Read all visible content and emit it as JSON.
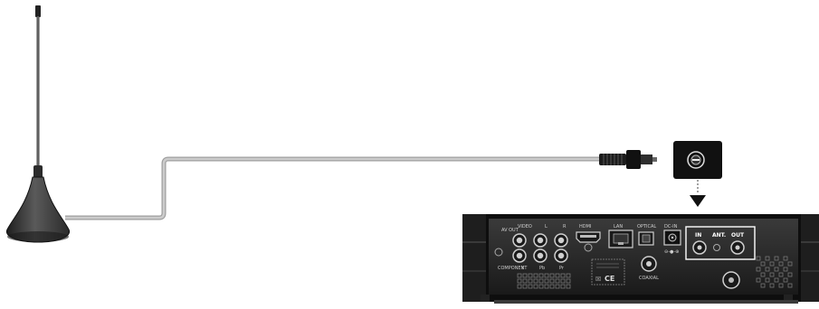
{
  "diagram": {
    "panel_labels": {
      "av_out": "AV OUT",
      "video": "VIDEO",
      "left": "L",
      "right": "R",
      "hdmi": "HDMI",
      "lan": "LAN",
      "optical": "OPTICAL",
      "dc_in": "DC-IN",
      "component": "COMPONENT",
      "y": "Y",
      "pb": "Pb",
      "pr": "Pr",
      "coaxial": "COAXIAL",
      "ant_in": "IN",
      "ant": "ANT.",
      "ant_out": "OUT",
      "ce_mark": "CE"
    },
    "colors": {
      "cable": "#b8b8b8",
      "antenna_base": "#3a3a3a",
      "device_body": "#1a1a1a",
      "panel": "#2a2a2a",
      "callout_box": "#111111",
      "arrow": "#111111"
    },
    "icons": [
      "antenna-icon",
      "coax-plug-icon",
      "antenna-socket-icon",
      "down-arrow-icon"
    ]
  }
}
